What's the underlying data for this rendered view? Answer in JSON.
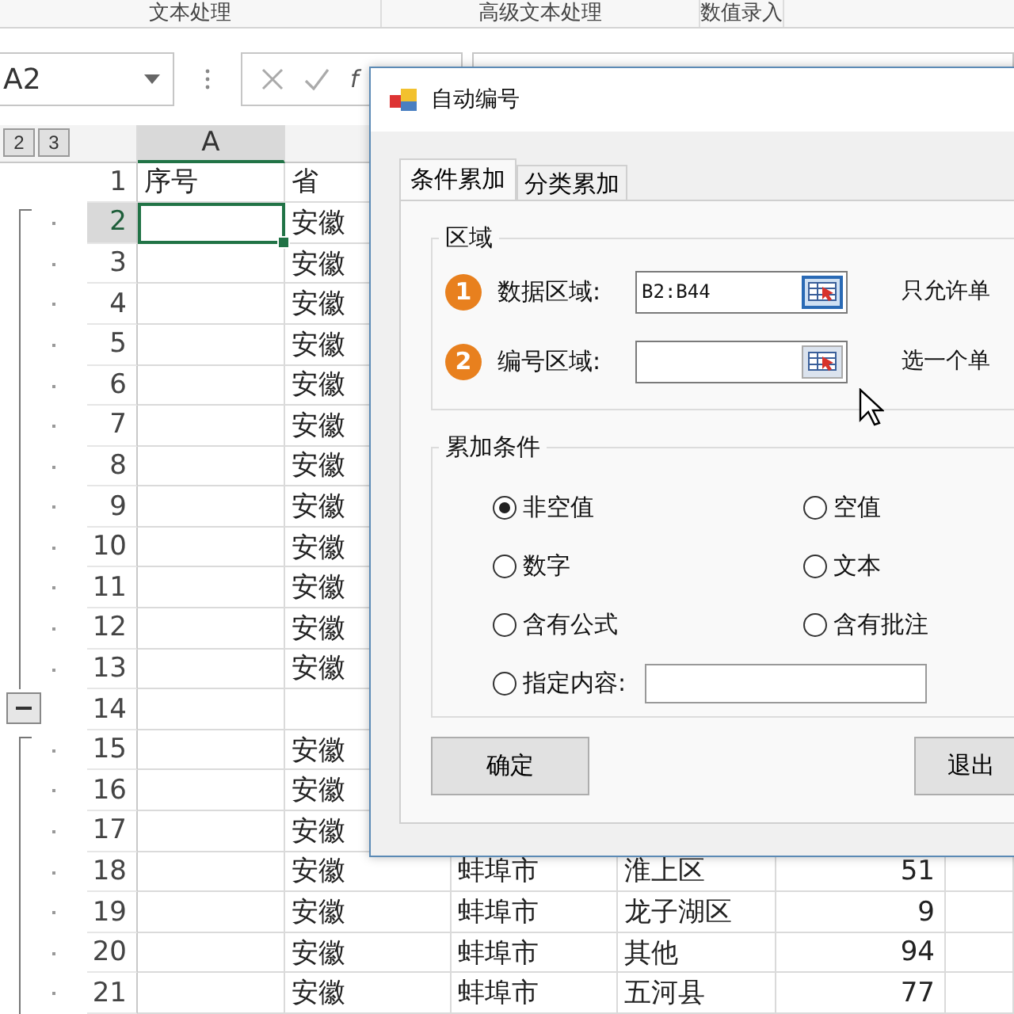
{
  "ribbon": {
    "groups": [
      "文本处理",
      "高级文本处理",
      "数值录入"
    ]
  },
  "formula_bar": {
    "name_box": "A2",
    "fx": "f"
  },
  "sheet": {
    "outline_levels": [
      "2",
      "3"
    ],
    "columns": [
      "A"
    ],
    "rows": [
      {
        "num": "1",
        "kind": "header",
        "selected": false,
        "a": "序号",
        "b": "省"
      },
      {
        "num": "2",
        "kind": "detail",
        "selected": true,
        "b": "安徽"
      },
      {
        "num": "3",
        "kind": "detail",
        "selected": false,
        "b": "安徽"
      },
      {
        "num": "4",
        "kind": "detail",
        "selected": false,
        "b": "安徽"
      },
      {
        "num": "5",
        "kind": "detail",
        "selected": false,
        "b": "安徽"
      },
      {
        "num": "6",
        "kind": "detail",
        "selected": false,
        "b": "安徽"
      },
      {
        "num": "7",
        "kind": "detail",
        "selected": false,
        "b": "安徽"
      },
      {
        "num": "8",
        "kind": "detail",
        "selected": false,
        "b": "安徽"
      },
      {
        "num": "9",
        "kind": "detail",
        "selected": false,
        "b": "安徽"
      },
      {
        "num": "10",
        "kind": "detail",
        "selected": false,
        "b": "安徽"
      },
      {
        "num": "11",
        "kind": "detail",
        "selected": false,
        "b": "安徽"
      },
      {
        "num": "12",
        "kind": "detail",
        "selected": false,
        "b": "安徽"
      },
      {
        "num": "13",
        "kind": "detail",
        "selected": false,
        "b": "安徽"
      },
      {
        "num": "14",
        "kind": "summary",
        "selected": false
      },
      {
        "num": "15",
        "kind": "detail",
        "selected": false,
        "b": "安徽"
      },
      {
        "num": "16",
        "kind": "detail",
        "selected": false,
        "b": "安徽"
      },
      {
        "num": "17",
        "kind": "detail",
        "selected": false,
        "b": "安徽"
      },
      {
        "num": "18",
        "kind": "detail",
        "selected": false,
        "b": "安徽",
        "c": "蚌埠市",
        "d": "淮上区",
        "e": "51"
      },
      {
        "num": "19",
        "kind": "detail",
        "selected": false,
        "b": "安徽",
        "c": "蚌埠市",
        "d": "龙子湖区",
        "e": "9"
      },
      {
        "num": "20",
        "kind": "detail",
        "selected": false,
        "b": "安徽",
        "c": "蚌埠市",
        "d": "其他",
        "e": "94"
      },
      {
        "num": "21",
        "kind": "detail",
        "selected": false,
        "b": "安徽",
        "c": "蚌埠市",
        "d": "五河县",
        "e": "77"
      }
    ]
  },
  "dialog": {
    "title": "自动编号",
    "tabs": [
      {
        "label": "条件累加",
        "selected": true
      },
      {
        "label": "分类累加",
        "selected": false
      }
    ],
    "range_group": {
      "title": "区域",
      "fields": [
        {
          "step": "1",
          "label": "数据区域:",
          "value": "B2:B44",
          "note": "只允许单"
        },
        {
          "step": "2",
          "label": "编号区域:",
          "note": "选一个单"
        }
      ]
    },
    "condition_group": {
      "title": "累加条件",
      "options": [
        {
          "label": "非空值",
          "selected": true,
          "kind": "plain"
        },
        {
          "label": "空值",
          "selected": false,
          "kind": "plain"
        },
        {
          "label": "数字",
          "selected": false,
          "kind": "plain"
        },
        {
          "label": "文本",
          "selected": false,
          "kind": "plain"
        },
        {
          "label": "含有公式",
          "selected": false,
          "kind": "plain"
        },
        {
          "label": "含有批注",
          "selected": false,
          "kind": "plain"
        },
        {
          "label": "指定内容:",
          "selected": false,
          "kind": "text-input"
        }
      ]
    },
    "buttons": [
      "确定",
      "退出"
    ]
  }
}
